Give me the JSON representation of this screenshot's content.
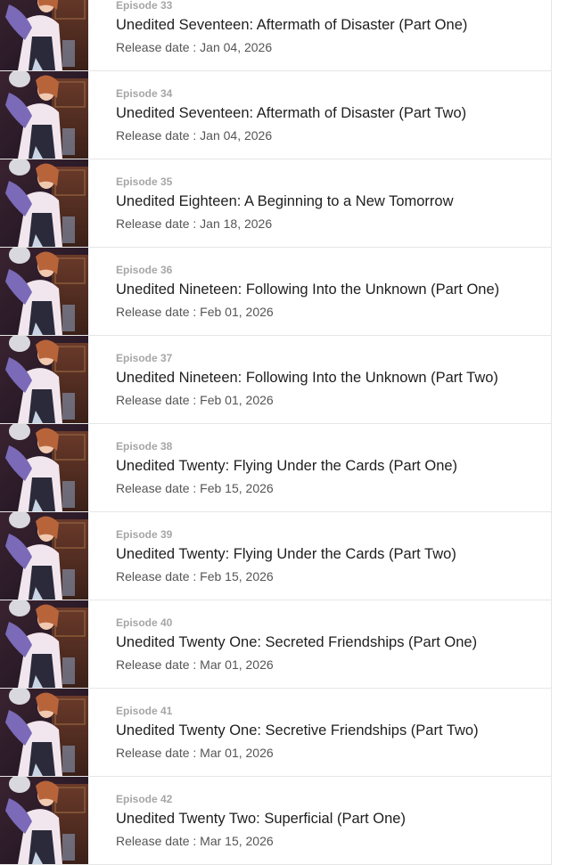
{
  "episodes": [
    {
      "number": "Episode 33",
      "title": "Unedited Seventeen: Aftermath of Disaster (Part One)",
      "release": "Release date : Jan 04, 2026"
    },
    {
      "number": "Episode 34",
      "title": "Unedited Seventeen: Aftermath of Disaster (Part Two)",
      "release": "Release date : Jan 04, 2026"
    },
    {
      "number": "Episode 35",
      "title": "Unedited Eighteen: A Beginning to a New Tomorrow",
      "release": "Release date : Jan 18, 2026"
    },
    {
      "number": "Episode 36",
      "title": "Unedited Nineteen: Following Into the Unknown (Part One)",
      "release": "Release date : Feb 01, 2026"
    },
    {
      "number": "Episode 37",
      "title": "Unedited Nineteen: Following Into the Unknown (Part Two)",
      "release": "Release date : Feb 01, 2026"
    },
    {
      "number": "Episode 38",
      "title": "Unedited Twenty: Flying Under the Cards (Part One)",
      "release": "Release date : Feb 15, 2026"
    },
    {
      "number": "Episode 39",
      "title": "Unedited Twenty: Flying Under the Cards (Part Two)",
      "release": "Release date : Feb 15, 2026"
    },
    {
      "number": "Episode 40",
      "title": "Unedited Twenty One: Secreted Friendships (Part One)",
      "release": "Release date : Mar 01, 2026"
    },
    {
      "number": "Episode 41",
      "title": "Unedited Twenty One: Secretive Friendships (Part Two)",
      "release": "Release date : Mar 01, 2026"
    },
    {
      "number": "Episode 42",
      "title": "Unedited Twenty Two: Superficial (Part One)",
      "release": "Release date : Mar 15, 2026"
    }
  ],
  "thumbnail_icon": "cover-art-thumbnail",
  "colors": {
    "title": "#1e1e1e",
    "episode_number": "#a6a6a6",
    "release_date": "#555555",
    "divider": "#e6e6e6"
  }
}
